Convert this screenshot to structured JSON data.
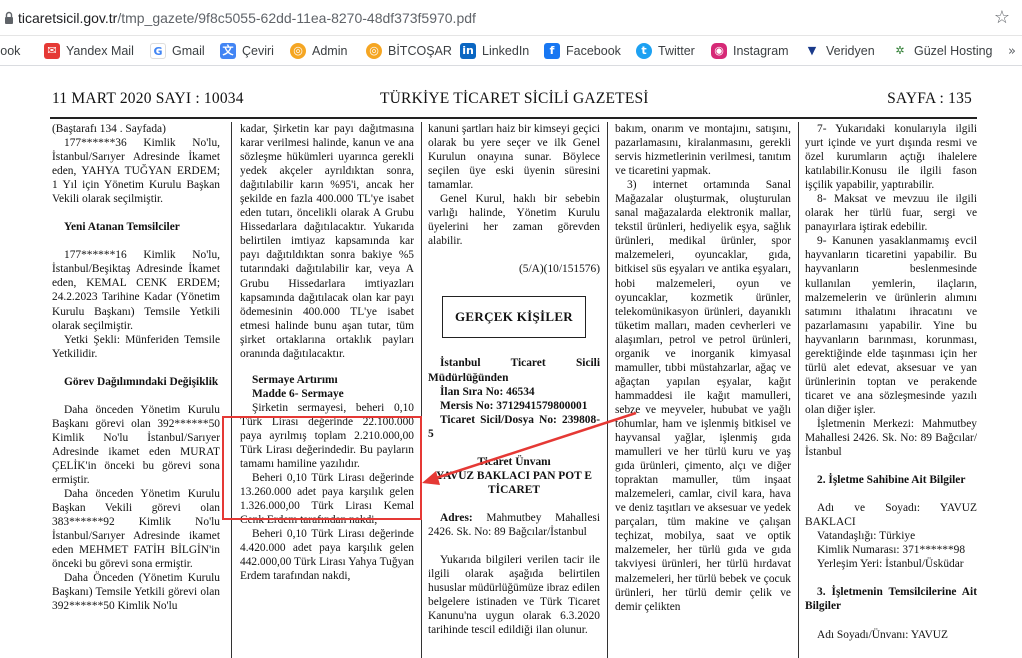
{
  "browser": {
    "url_host": "ticaretsicil.gov.tr",
    "url_path": "/tmp_gazete/9f8c5055-62dd-11ea-8270-48df373f5970.pdf",
    "bookmarks": [
      {
        "label": "tlook",
        "icon": "outlook-icon",
        "color": "#0078d4",
        "glyph": ""
      },
      {
        "label": "Yandex Mail",
        "icon": "mail-icon",
        "color": "#e53935",
        "glyph": "✉"
      },
      {
        "label": "Gmail",
        "icon": "google-icon",
        "color": "#4285f4",
        "glyph": "G"
      },
      {
        "label": "Çeviri",
        "icon": "translate-icon",
        "color": "#4285f4",
        "glyph": "文"
      },
      {
        "label": "Admin",
        "icon": "coin-icon",
        "color": "#f5a623",
        "glyph": "◎"
      },
      {
        "label": "BİTCOŞAR",
        "icon": "coin-icon",
        "color": "#f5a623",
        "glyph": "◎"
      },
      {
        "label": "LinkedIn",
        "icon": "linkedin-icon",
        "color": "#0a66c2",
        "glyph": "in"
      },
      {
        "label": "Facebook",
        "icon": "facebook-icon",
        "color": "#1877f2",
        "glyph": "f"
      },
      {
        "label": "Twitter",
        "icon": "twitter-icon",
        "color": "#1da1f2",
        "glyph": "t"
      },
      {
        "label": "Instagram",
        "icon": "instagram-icon",
        "color": "#d62976",
        "glyph": "◉"
      },
      {
        "label": "Veridyen",
        "icon": "veridyen-icon",
        "color": "#1a3a8a",
        "glyph": "▼"
      },
      {
        "label": "Güzel Hosting",
        "icon": "hosting-icon",
        "color": "#2e7d32",
        "glyph": "✲"
      }
    ]
  },
  "gazette": {
    "header_left": "11 MART 2020 SAYI : 10034",
    "header_center": "TÜRKİYE TİCARET SİCİLİ GAZETESİ",
    "header_right": "SAYFA : 135"
  },
  "col1": {
    "p1": "(Baştarafı 134 . Sayfada)",
    "p2": "177******36 Kimlik No'lu, İstanbul/Sarıyer Adresinde İkamet eden, YAHYA TUĞYAN ERDEM; 1 Yıl için Yönetim Kurulu Başkan Vekili olarak seçilmiştir.",
    "h1": "Yeni Atanan Temsilciler",
    "p3": "177******16 Kimlik No'lu, İstanbul/Beşiktaş Adresinde İkamet eden, KEMAL CENK ERDEM; 24.2.2023 Tarihine Kadar (Yönetim Kurulu Başkanı) Temsile Yetkili olarak seçilmiştir.",
    "p4": "Yetki Şekli: Münferiden Temsile Yetkilidir.",
    "h2": "Görev Dağılımındaki Değişiklik",
    "p5": "Daha önceden Yönetim Kurulu Başkanı görevi olan 392******50 Kimlik No'lu İstanbul/Sarıyer Adresinde ikamet eden MURAT ÇELİK'in önceki bu görevi sona ermiştir.",
    "p6": "Daha önceden Yönetim Kurulu Başkan Vekili görevi olan 383******92 Kimlik No'lu İstanbul/Sarıyer Adresinde ikamet eden MEHMET FATİH BİLGİN'in önceki bu görevi sona ermiştir.",
    "p7": "Daha Önceden (Yönetim Kurulu Başkanı) Temsile Yetkili görevi olan 392******50 Kimlik No'lu"
  },
  "col2": {
    "p1": "kadar, Şirketin kar payı dağıtmasına karar verilmesi halinde, kanun ve ana sözleşme hükümleri uyarınca gerekli yedek akçeler ayrıldıktan sonra, dağıtılabilir karın %95'i, ancak her şekilde en fazla 400.000 TL'ye isabet eden tutarı, öncelikli olarak A Grubu Hissedarlara dağıtılacaktır. Yukarıda belirtilen imtiyaz kapsamında kar payı dağıtıldıktan sonra bakiye %5 tutarındaki dağıtılabilir kar, veya A Grubu Hissedarlara imtiyazları kapsamında dağıtılacak olan kar payı ödemesinin 400.000 TL'ye isabet etmesi halinde bunu aşan tutar, tüm şirket ortaklarına ortaklık payları oranında dağıtılacaktır.",
    "h1": "Sermaye Artırımı",
    "h2": "Madde 6- Sermaye",
    "p2": "Şirketin sermayesi, beheri 0,10 Türk Lirası değerinde 22.100.000 paya ayrılmış toplam 2.210.000,00 Türk Lirası değerindedir. Bu payların tamamı hamiline yazılıdır.",
    "p3": "Beheri 0,10 Türk Lirası değerinde 13.260.000 adet paya karşılık gelen 1.326.000,00 Türk Lirası Kemal Cenk Erdem tarafından nakdi,",
    "p4": "Beheri 0,10 Türk Lirası değerinde 4.420.000 adet paya karşılık gelen 442.000,00 Türk Lirası Yahya Tuğyan Erdem tarafından nakdi,"
  },
  "col3": {
    "p1": "kanuni şartları haiz bir kimseyi geçici olarak bu yere seçer ve ilk Genel Kurulun onayına sunar. Böylece seçilen üye eski üyenin süresini tamamlar.",
    "p2": "Genel Kurul, haklı bir sebebin varlığı halinde, Yönetim Kurulu üyelerini her zaman görevden alabilir.",
    "ref": "(5/A)(10/151576)",
    "box": "GERÇEK KİŞİLER",
    "office": "İstanbul Ticaret Sicili Müdürlüğünden",
    "ilan": "İlan Sıra No: 46534",
    "mersis": "Mersis No: 3712941579800001",
    "sicil": "Ticaret Sicil/Dosya No: 239808- 5",
    "unvan_label": "Ticaret Ünvanı",
    "unvan": "YAVUZ BAKLACI PAN POT E TİCARET",
    "adres_label": "Adres:",
    "adres": "Mahmutbey Mahallesi 2426. Sk. No: 89 Bağcılar/İstanbul",
    "p3": "Yukarıda bilgileri verilen tacir ile ilgili olarak aşağıda belirtilen hususlar müdürlüğümüze ibraz edilen belgelere istinaden ve Türk Ticaret Kanunu'na uygun olarak 6.3.2020 tarihinde tescil edildiği ilan olunur."
  },
  "col4": {
    "p1": "bakım, onarım ve montajını, satışını, pazarlamasını, kiralanmasını, gerekli servis hizmetlerinin verilmesi, tanıtım ve ticaretini yapmak.",
    "p2": "3) internet ortamında Sanal Mağazalar oluşturmak, oluşturulan sanal mağazalarda elektronik mallar, tekstil ürünleri, hediyelik eşya, sağlık ürünleri, medikal ürünler, spor malzemeleri, oyuncaklar, gıda, bitkisel süs eşyaları ve antika eşyaları, hobi malzemeleri, oyun ve oyuncaklar, kozmetik ürünler, telekomünikasyon ürünleri, dayanıklı tüketim malları, maden cevherleri ve alaşımları, petrol ve petrol ürünleri, organik ve inorganik kimyasal mamuller, tıbbi müstahzarlar, ağaç ve ağaçtan yapılan eşyalar, kağıt hammaddesi ile kağıt mamulleri, sebze ve meyveler, hububat ve yağlı tohumlar, ham ve işlenmiş bitkisel ve hayvansal yağlar, işlenmiş gıda mamulleri ve her türlü kuru ve yaş gıda ürünleri, çimento, alçı ve diğer topraktan mamuller, tüm inşaat malzemeleri, camlar, civil kara, hava ve deniz taşıtları ve aksesuar ve yedek parçaları, tüm makine ve çalışan teçhizat, mobilya, saat ve optik malzemeler, her türlü gıda ve gıda takviyesi ürünleri, her türlü hırdavat malzemeleri, her türlü bebek ve çocuk ürünleri, her türlü demir çelik ve demir çelikten"
  },
  "col5": {
    "p1": "7- Yukarıdaki konularıyla ilgili yurt içinde ve yurt dışında resmi ve özel kurumların açtığı ihalelere katılabilir.Konusu ile ilgili fason işçilik yapabilir, yaptırabilir.",
    "p2": "8- Maksat ve mevzuu ile ilgili olarak her türlü fuar, sergi ve panayırlara iştirak edebilir.",
    "p3": "9- Kanunen yasaklanmamış evcil hayvanların ticaretini yapabilir. Bu hayvanların beslenmesinde kullanılan yemlerin, ilaçların, malzemelerin ve ürünlerin alımını satımını ithalatını ihracatını ve pazarlamasını yapabilir. Yine bu hayvanların barınması, korunması, gerektiğinde elde taşınması için her türlü alet edevat, aksesuar ve yan ürünlerinin toptan ve perakende ticaret ve ana sözleşmesinde yazılı olan diğer işler.",
    "p4": "İşletmenin Merkezi: Mahmutbey Mahallesi 2426. Sk. No: 89 Bağcılar/İstanbul",
    "h1": "2. İşletme Sahibine Ait Bilgiler",
    "p5": "Adı ve Soyadı: YAVUZ BAKLACI",
    "p6": "Vatandaşlığı: Türkiye",
    "p7": "Kimlik Numarası: 371******98",
    "p8": "Yerleşim Yeri: İstanbul/Üsküdar",
    "h2": "3. İşletmenin Temsilcilerine Ait Bilgiler",
    "p9": "Adı Soyadı/Ünvanı: YAVUZ"
  },
  "annotation": {
    "color": "#e53935"
  }
}
